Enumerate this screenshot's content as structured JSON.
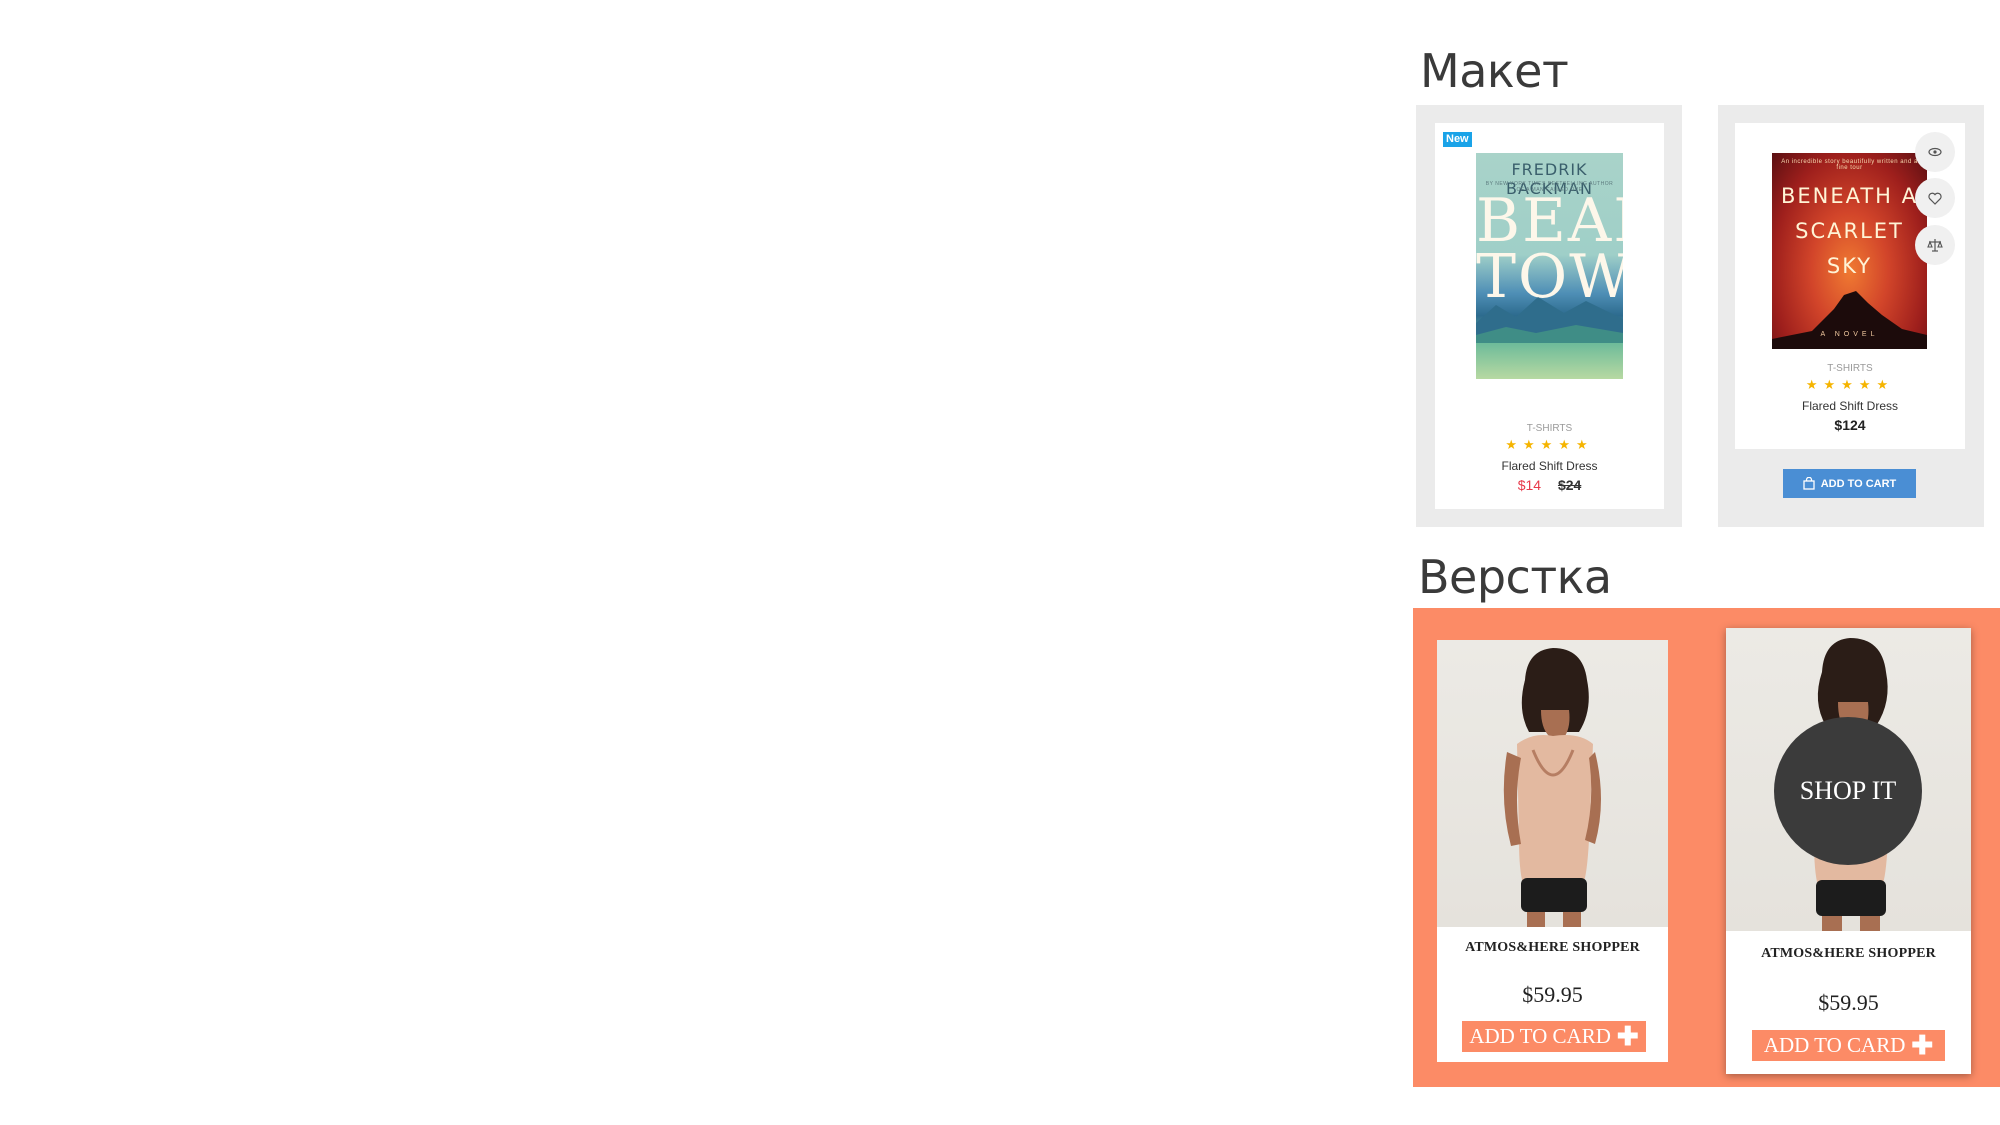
{
  "mockup": {
    "title": "Макет",
    "card1": {
      "badge": "New",
      "cover_author": "FREDRIK BACKMAN",
      "cover_subtitle": "BY NEW YORK TIMES BESTSELLING AUTHOR OF A MAN CALLED OVE",
      "cover_title_line1": "BEAR",
      "cover_title_line2": "TOWN",
      "category": "T-SHIRTS",
      "stars": "★★★★★",
      "rating": 5,
      "name": "Flared Shift Dress",
      "price_sale": "$14",
      "price_old": "$24"
    },
    "card2": {
      "cover_subtitle": "An incredible story beautifully written and a fine tour",
      "cover_title_line1": "BENEATH A",
      "cover_title_line2": "SCARLET",
      "cover_title_line3": "SKY",
      "cover_tag": "A NOVEL",
      "category": "T-SHIRTS",
      "stars": "★★★★★",
      "rating": 5,
      "name": "Flared Shift Dress",
      "price": "$124",
      "add_to_cart": "ADD TO CART",
      "icons": [
        "eye-icon",
        "heart-icon",
        "compare-icon"
      ]
    },
    "colors": {
      "badge": "#1aa3e8",
      "sale": "#e8394a",
      "button": "#4a8ed4",
      "stars": "#f5b400"
    }
  },
  "layout": {
    "title": "Верстка",
    "card1": {
      "name": "ATMOS&HERE SHOPPER",
      "price": "$59.95",
      "button": "ADD TO CARD"
    },
    "card2": {
      "name": "ATMOS&HERE SHOPPER",
      "price": "$59.95",
      "button": "ADD TO CARD",
      "overlay": "SHOP IT"
    },
    "colors": {
      "accent": "#fc8b66",
      "overlay": "#3b3b3b"
    }
  }
}
